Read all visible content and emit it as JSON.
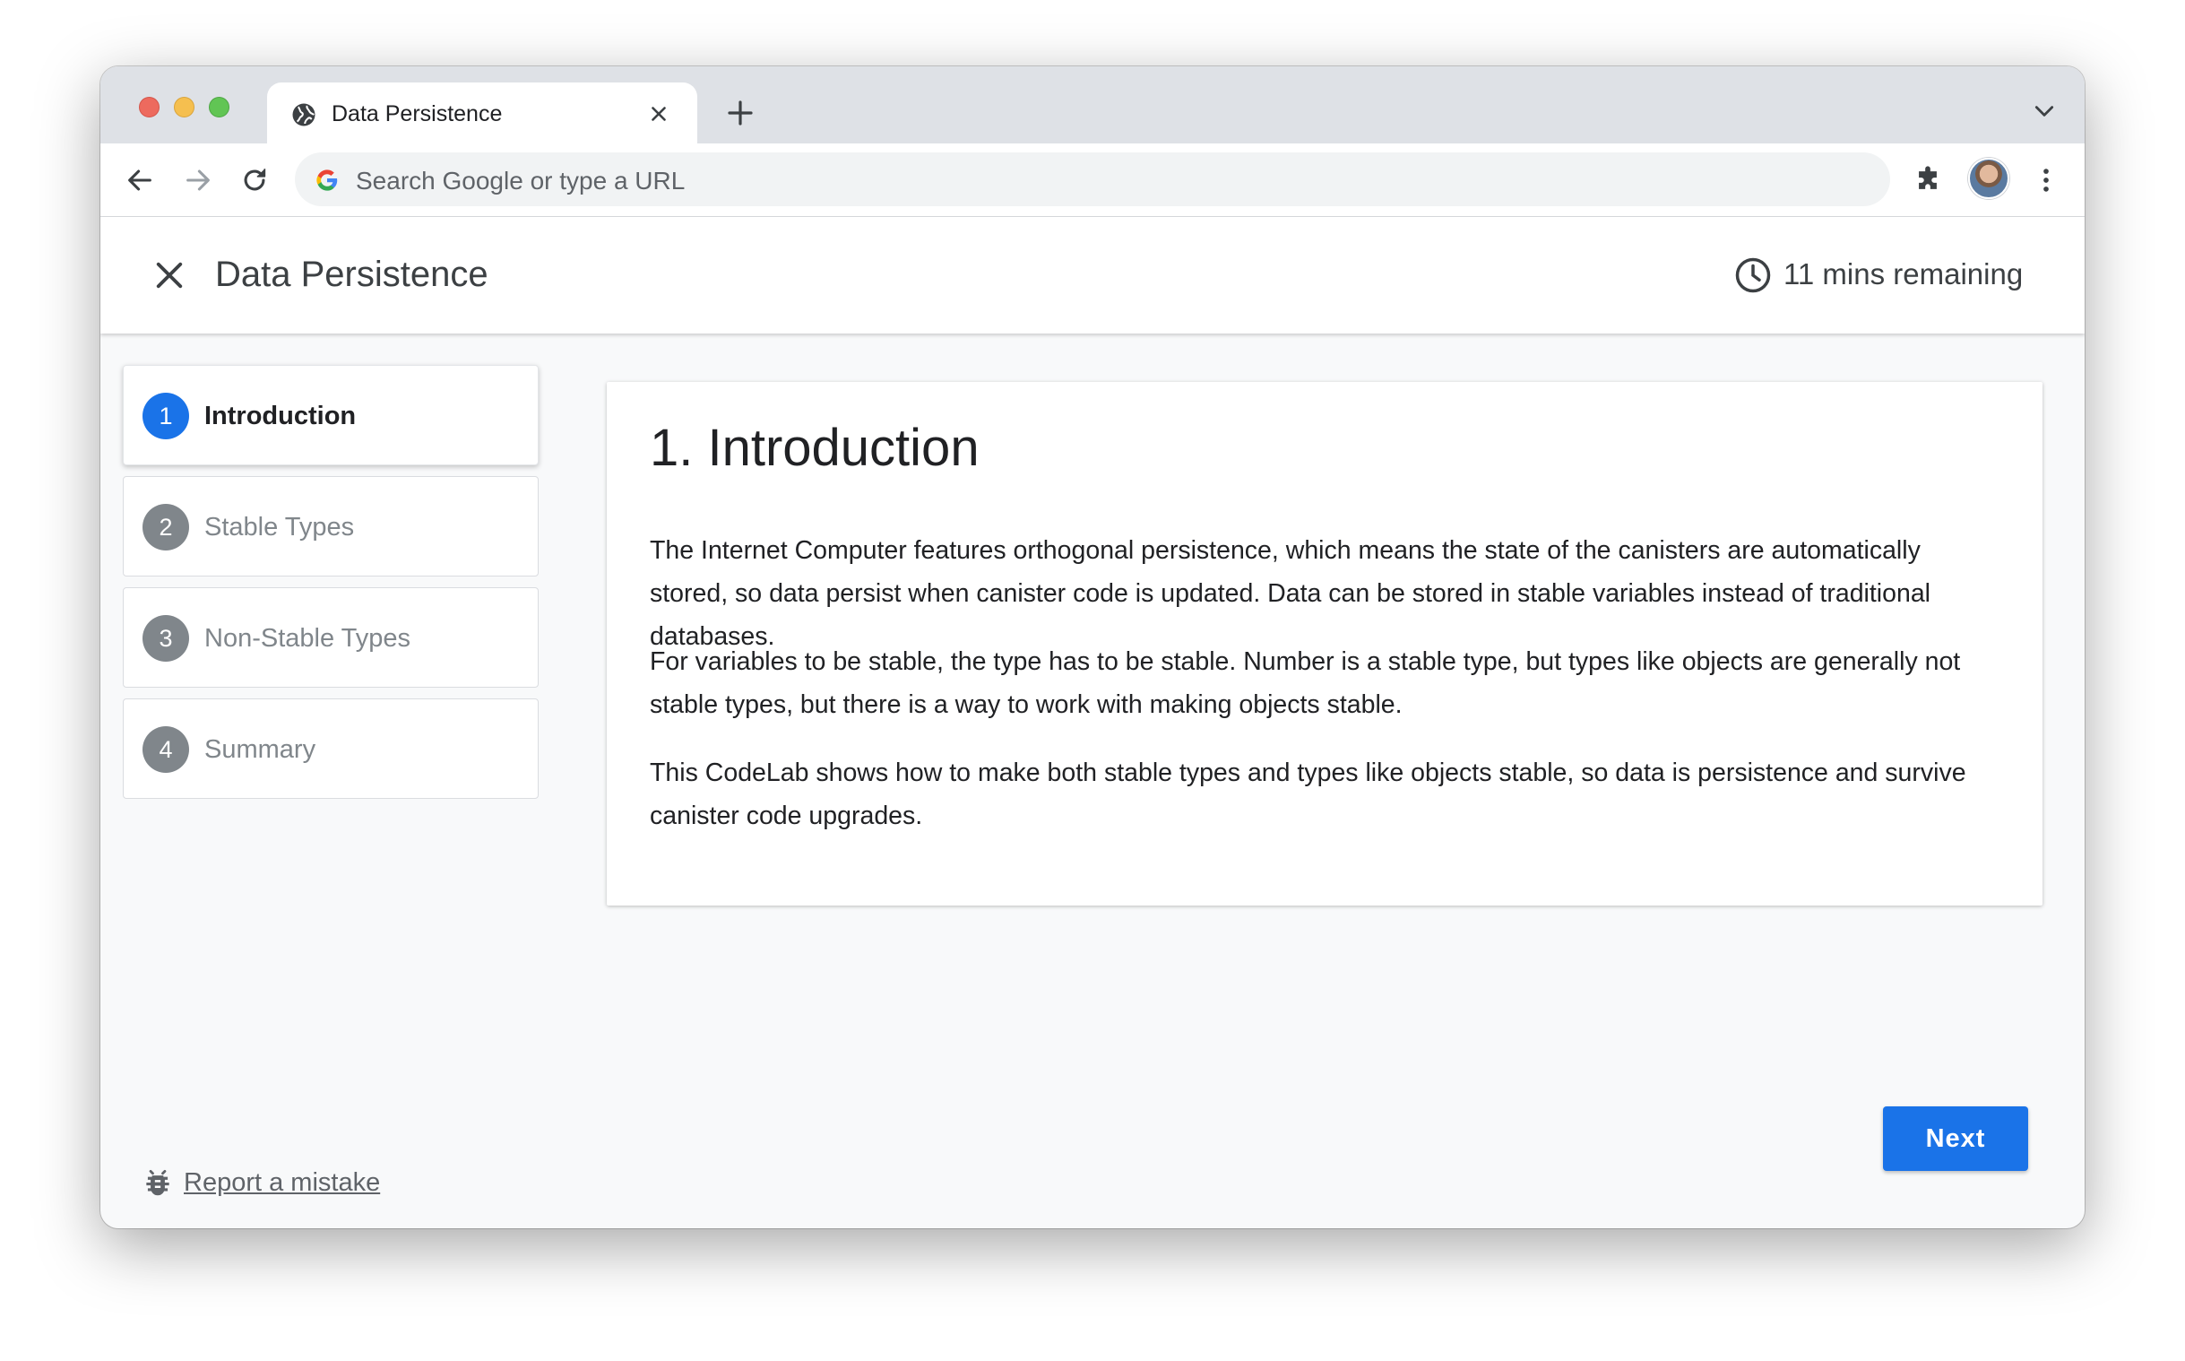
{
  "browser": {
    "tab_title": "Data Persistence",
    "omnibox_placeholder": "Search Google or type a URL",
    "icons": [
      "globe-icon",
      "close-icon",
      "plus-icon",
      "chevron-down-icon",
      "back-icon",
      "forward-icon",
      "reload-icon",
      "google-icon",
      "extensions-icon",
      "avatar",
      "more-vert-icon"
    ]
  },
  "header": {
    "title": "Data Persistence",
    "time_remaining": "11 mins remaining"
  },
  "steps": [
    {
      "number": "1",
      "label": "Introduction",
      "active": true
    },
    {
      "number": "2",
      "label": "Stable Types",
      "active": false
    },
    {
      "number": "3",
      "label": "Non-Stable Types",
      "active": false
    },
    {
      "number": "4",
      "label": "Summary",
      "active": false
    }
  ],
  "content": {
    "heading": "1. Introduction",
    "paragraphs": [
      "The Internet Computer features orthogonal persistence, which means the state of the canisters are automatically stored, so data persist when canister code is updated. Data can be stored in stable variables instead of traditional databases.",
      "For variables to be stable, the type has to be stable. Number is a stable type, but types like objects are generally not stable types, but there is a way to work with making objects stable.",
      "This CodeLab shows how to make both stable types and types like objects stable, so data is persistence and survive canister code upgrades."
    ]
  },
  "footer": {
    "report_label": "Report a mistake",
    "next_label": "Next"
  },
  "colors": {
    "accent": "#1a73e8",
    "step_inactive": "#80868b",
    "background": "#f8f9fa"
  }
}
